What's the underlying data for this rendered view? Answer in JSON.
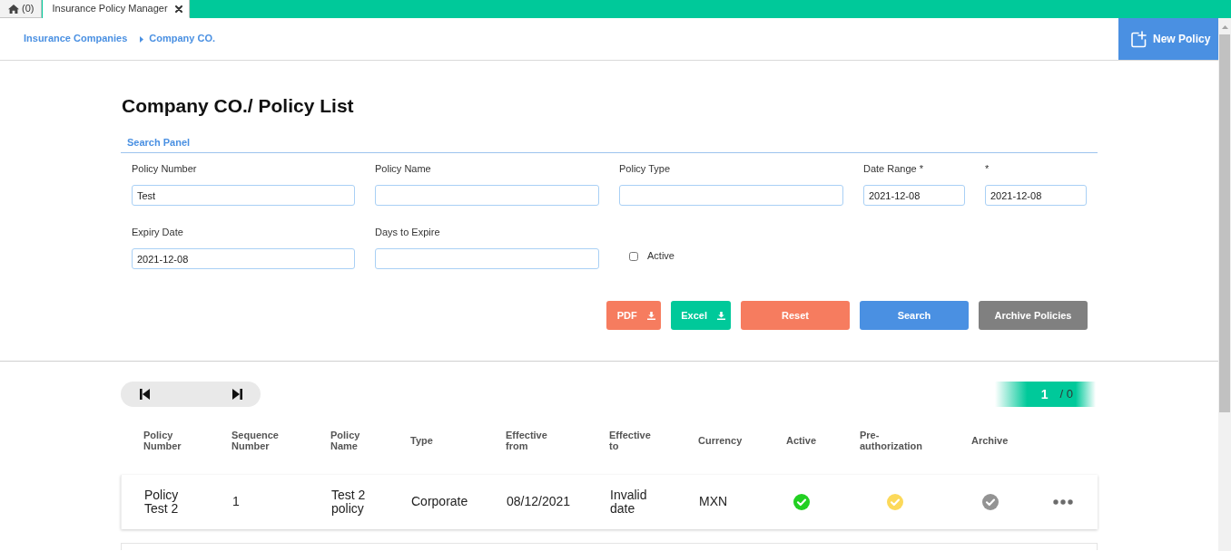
{
  "tabs": [
    {
      "kind": "home",
      "label": "(0)",
      "selected": false,
      "closable": false
    },
    {
      "kind": "page",
      "label": "Insurance Policy Manager",
      "selected": true,
      "closable": true
    }
  ],
  "breadcrumb": [
    {
      "label": "Insurance Companies"
    },
    {
      "label": "Company CO."
    }
  ],
  "new_policy_button": {
    "label": "New Policy"
  },
  "page_title": "Company CO./ Policy List",
  "search_panel": {
    "title": "Search Panel",
    "rows": [
      [
        {
          "kind": "input",
          "label": "Policy Number",
          "value": "Test"
        },
        {
          "kind": "input",
          "label": "Policy Name"
        },
        {
          "kind": "input",
          "label": "Policy Type"
        },
        {
          "kind": "input",
          "label": "Date Range *",
          "value": "2021-12-08"
        },
        {
          "kind": "input",
          "label": "*",
          "value": "2021-12-08"
        }
      ],
      [
        {
          "kind": "input",
          "label": "Expiry Date",
          "value": "2021-12-08"
        },
        {
          "kind": "input",
          "label": "Days to Expire"
        },
        {
          "kind": "checkbox",
          "label": "Active",
          "checked": false
        }
      ]
    ],
    "buttons": [
      {
        "label": "PDF",
        "color": "#f67c5f",
        "download": true
      },
      {
        "label": "Excel",
        "color": "#00c99a",
        "download": true
      },
      {
        "label": "Reset",
        "color": "#f67c5f",
        "download": false
      },
      {
        "label": "Search",
        "color": "#4a90e2",
        "download": false
      },
      {
        "label": "Archive Policies",
        "color": "#808080",
        "download": false
      }
    ]
  },
  "pager": {
    "current_page": "1",
    "total": "/ 0"
  },
  "table": {
    "columns": [
      "Policy Number",
      "Sequence Number",
      "Policy Name",
      "Type",
      "Effective from",
      "Effective to",
      "Currency",
      "Active",
      "Pre-authorization",
      "Archive"
    ],
    "rows": [
      {
        "cells": [
          {
            "kind": "text",
            "text": "Policy Test 2"
          },
          {
            "kind": "text",
            "text": "1"
          },
          {
            "kind": "text",
            "text": "Test 2 policy"
          },
          {
            "kind": "text",
            "text": "Corporate"
          },
          {
            "kind": "text",
            "text": "08/12/2021"
          },
          {
            "kind": "text",
            "text": "Invalid date"
          },
          {
            "kind": "text",
            "text": "MXN"
          },
          {
            "kind": "check",
            "color": "#22d022"
          },
          {
            "kind": "check",
            "color": "#fcd95a"
          },
          {
            "kind": "check",
            "color": "#939393"
          },
          {
            "kind": "menu"
          }
        ]
      }
    ]
  }
}
